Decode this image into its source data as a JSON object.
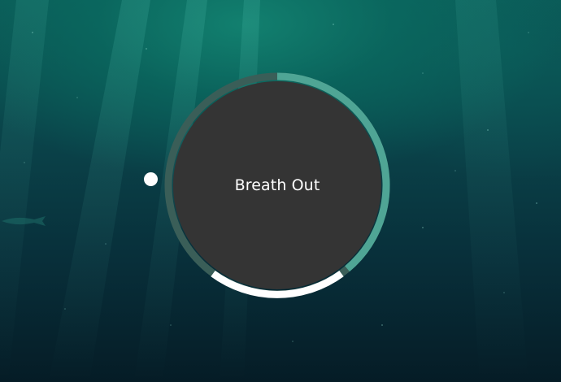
{
  "breathing_widget": {
    "phase_label": "Breath Out",
    "colors": {
      "ring_track": "#3a5e58",
      "ring_progress": "#4fa595",
      "ring_active": "#ffffff",
      "disc": "#343434",
      "indicator": "#ffffff"
    }
  }
}
